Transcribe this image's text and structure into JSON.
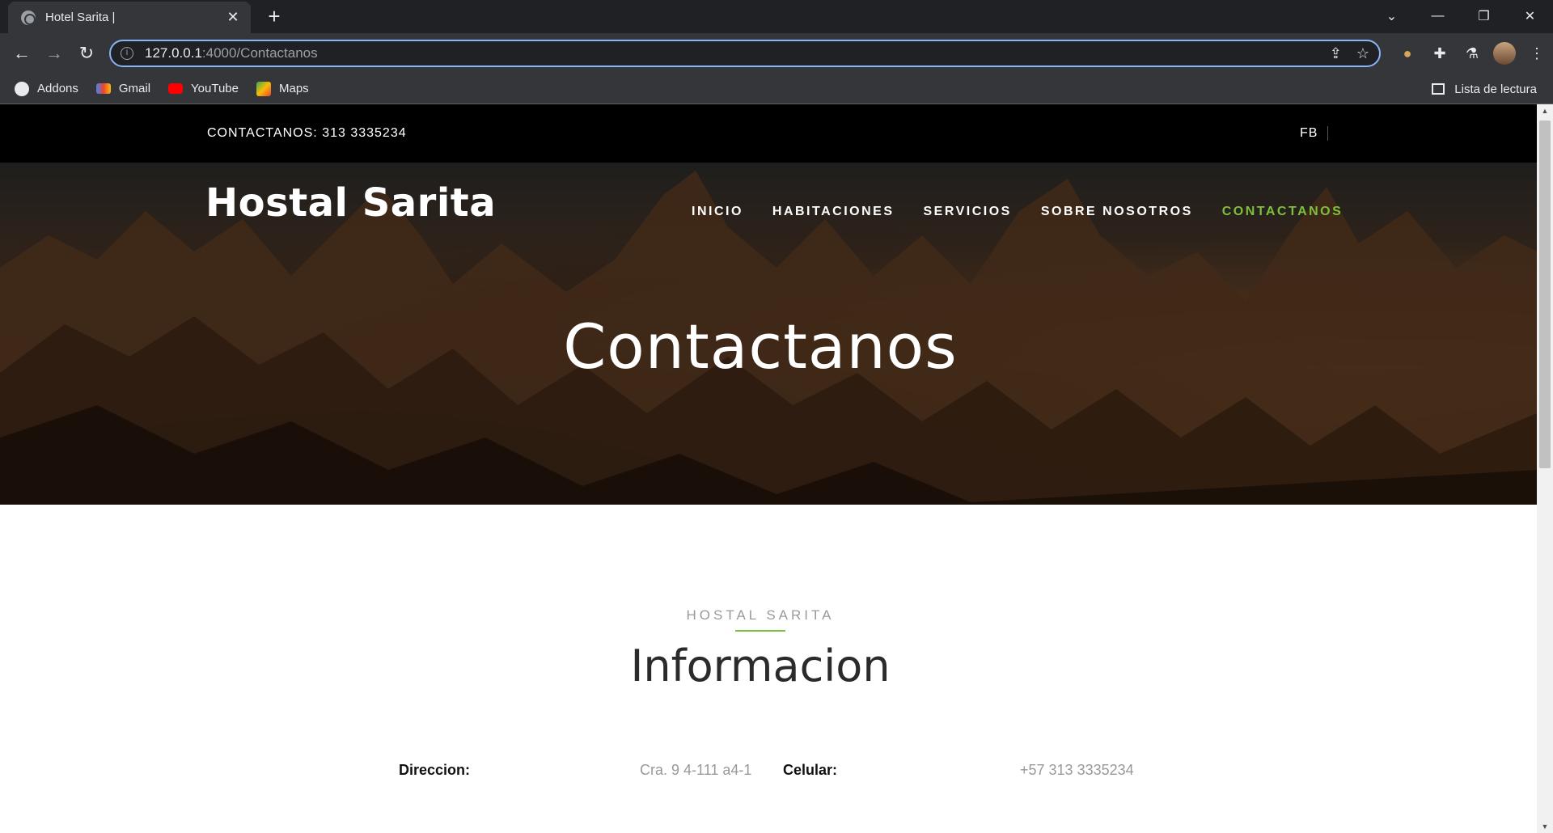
{
  "browser": {
    "tab_title": "Hotel Sarita |",
    "url_host": "127.0.0.1",
    "url_rest": ":4000/Contactanos",
    "bookmarks": [
      {
        "label": "Addons",
        "icon": "globe-icon"
      },
      {
        "label": "Gmail",
        "icon": "gmail-icon"
      },
      {
        "label": "YouTube",
        "icon": "youtube-icon"
      },
      {
        "label": "Maps",
        "icon": "maps-icon"
      }
    ],
    "reading_list": "Lista de lectura"
  },
  "topbar": {
    "contact": "CONTACTANOS: 313 3335234",
    "social": "FB"
  },
  "header": {
    "brand": "Hostal Sarita",
    "nav": [
      "INICIO",
      "HABITACIONES",
      "SERVICIOS",
      "SOBRE NOSOTROS",
      "CONTACTANOS"
    ],
    "active_nav": "CONTACTANOS",
    "accent_color": "#7cc03c"
  },
  "hero": {
    "title": "Contactanos"
  },
  "info": {
    "subtitle": "HOSTAL SARITA",
    "title": "Informacion",
    "fields": [
      {
        "label": "Direccion:",
        "value": "Cra. 9 4-111 a4-1"
      },
      {
        "label": "Celular:",
        "value": "+57 313 3335234"
      }
    ]
  }
}
